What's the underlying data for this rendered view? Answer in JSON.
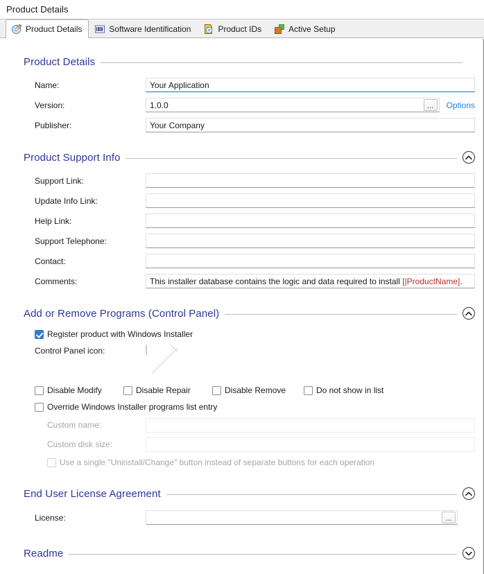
{
  "window": {
    "title": "Product Details"
  },
  "tabs": [
    {
      "label": "Product Details",
      "icon": "disc-pencil-icon",
      "active": true
    },
    {
      "label": "Software Identification",
      "icon": "barcode-icon",
      "active": false
    },
    {
      "label": "Product IDs",
      "icon": "disc-page-icon",
      "active": false
    },
    {
      "label": "Active Setup",
      "icon": "package-box-icon",
      "active": false
    }
  ],
  "sections": {
    "product_details": {
      "title": "Product Details",
      "collapsible": false,
      "fields": {
        "name_label": "Name:",
        "name_value": "Your Application",
        "version_label": "Version:",
        "version_value": "1.0.0",
        "version_browse": "...",
        "options_link": "Options",
        "publisher_label": "Publisher:",
        "publisher_value": "Your Company"
      }
    },
    "product_support_info": {
      "title": "Product Support Info",
      "collapsible": true,
      "expanded": true,
      "fields": {
        "support_link_label": "Support Link:",
        "support_link_value": "",
        "update_info_link_label": "Update Info Link:",
        "update_info_link_value": "",
        "help_link_label": "Help Link:",
        "help_link_value": "",
        "support_telephone_label": "Support Telephone:",
        "support_telephone_value": "",
        "contact_label": "Contact:",
        "contact_value": "",
        "comments_label": "Comments:",
        "comments_value_prefix": "This installer database contains the logic and data required to install ",
        "comments_value_token": "[|ProductName]",
        "comments_value_suffix": "."
      }
    },
    "add_remove_programs": {
      "title": "Add or Remove Programs (Control Panel)",
      "collapsible": true,
      "expanded": true,
      "register_checkbox": {
        "label": "Register product with Windows Installer",
        "checked": true
      },
      "control_panel_icon_label": "Control Panel icon:",
      "toggles": [
        {
          "label": "Disable Modify",
          "checked": false,
          "disabled": false
        },
        {
          "label": "Disable Repair",
          "checked": false,
          "disabled": false
        },
        {
          "label": "Disable Remove",
          "checked": false,
          "disabled": false
        },
        {
          "label": "Do not show in list",
          "checked": false,
          "disabled": false
        }
      ],
      "override_checkbox": {
        "label": "Override Windows Installer programs list entry",
        "checked": false
      },
      "custom_name_label": "Custom name:",
      "custom_name_value": "",
      "custom_disk_size_label": "Custom disk size:",
      "custom_disk_size_value": "",
      "single_button_checkbox": {
        "label": "Use a single \"Uninstall/Change\" button instead of separate buttons for each operation",
        "checked": false,
        "disabled": true
      }
    },
    "eula": {
      "title": "End User License Agreement",
      "collapsible": true,
      "expanded": true,
      "license_label": "License:",
      "license_value": "",
      "license_browse": "..."
    },
    "readme": {
      "title": "Readme",
      "collapsible": true,
      "expanded": false
    }
  },
  "colors": {
    "section_title": "#2f3699",
    "link": "#1a85e0",
    "checkbox_checked": "#2a7fd4",
    "focused_field_underline": "#1272c0",
    "token_text": "#b03030",
    "tab_strip_bg": "#f0f0f0"
  }
}
